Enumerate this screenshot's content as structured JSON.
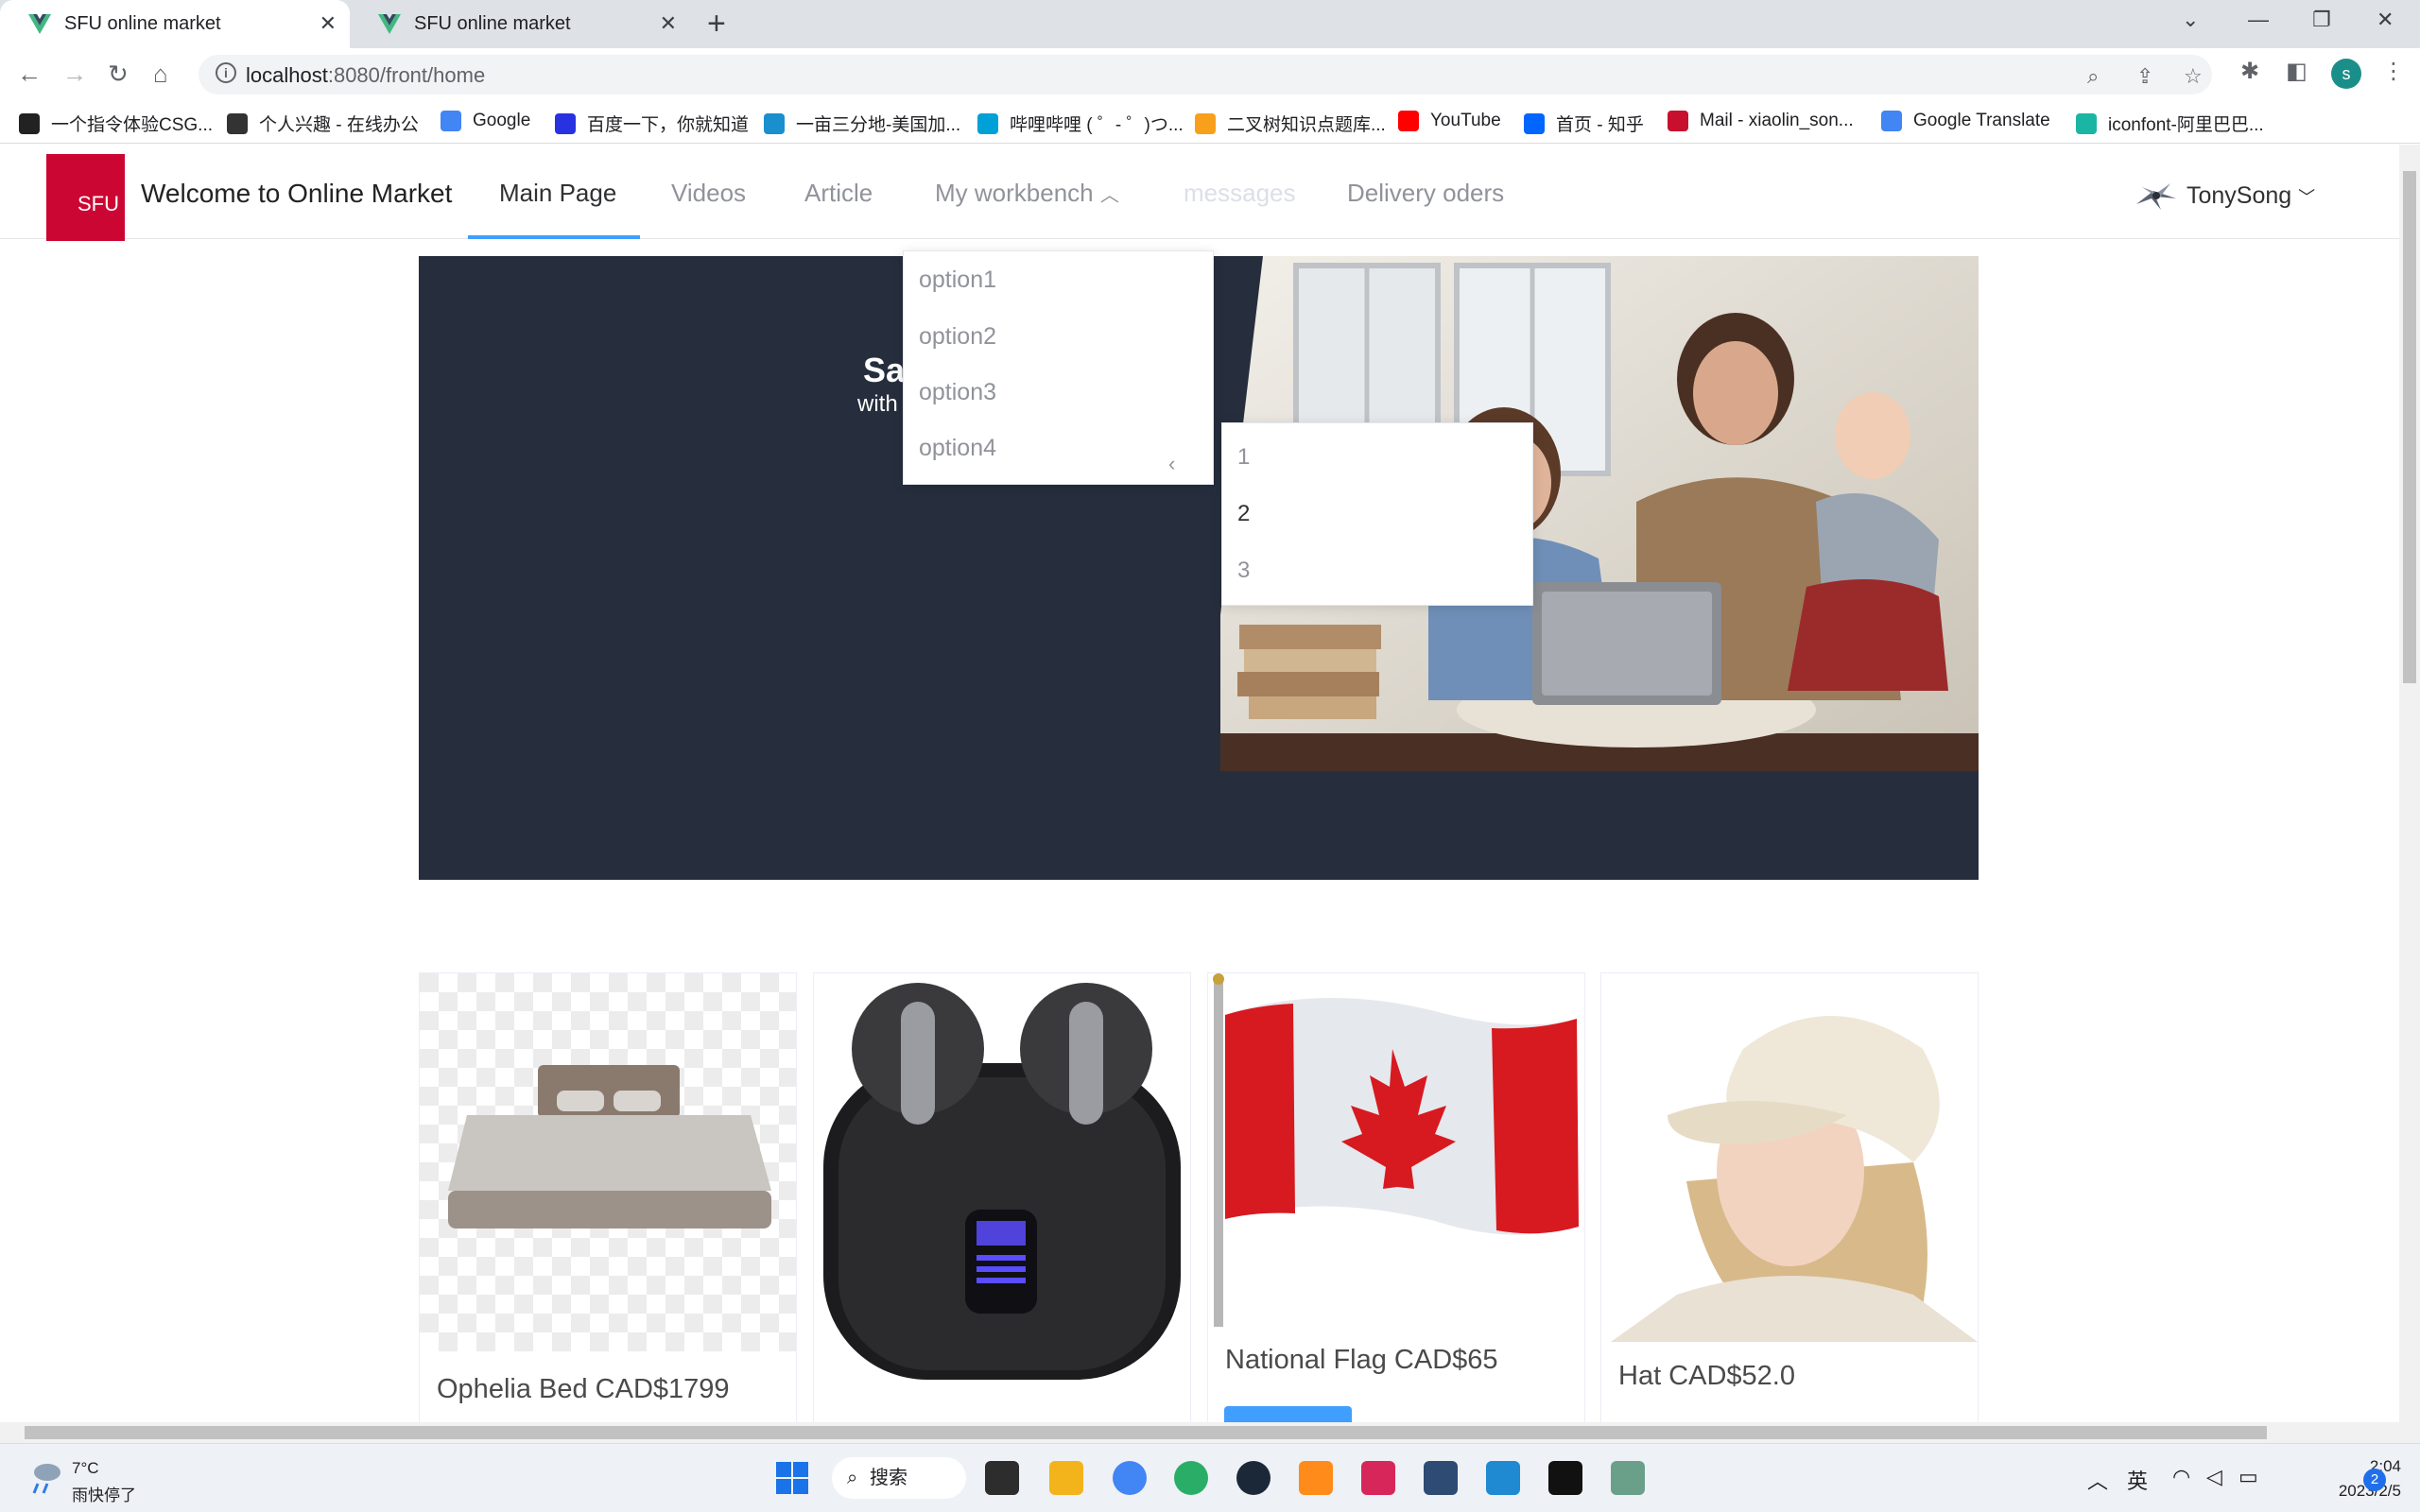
{
  "browser": {
    "tabs": [
      {
        "title": "SFU online market",
        "active": true
      },
      {
        "title": "SFU online market",
        "active": false
      }
    ],
    "url_host": "localhost",
    "url_path": ":8080/front/home",
    "profile_initial": "s",
    "bookmarks": [
      {
        "label": "一个指令体验CSG...",
        "icon": "csg-icon",
        "color": "#222222"
      },
      {
        "label": "个人兴趣 - 在线办公",
        "icon": "notion-icon",
        "color": "#333333"
      },
      {
        "label": "Google",
        "icon": "google-icon",
        "color": "#4285f4"
      },
      {
        "label": "百度一下，你就知道",
        "icon": "baidu-icon",
        "color": "#2932e1"
      },
      {
        "label": "一亩三分地-美国加...",
        "icon": "1point3acres-icon",
        "color": "#1a8fce"
      },
      {
        "label": "哔哩哔哩 ( ゜- ゜)つ...",
        "icon": "bilibili-icon",
        "color": "#00a1d6"
      },
      {
        "label": "二叉树知识点题库...",
        "icon": "leetcode-icon",
        "color": "#f89f1b"
      },
      {
        "label": "YouTube",
        "icon": "youtube-icon",
        "color": "#ff0000"
      },
      {
        "label": "首页 - 知乎",
        "icon": "zhihu-icon",
        "color": "#0066ff"
      },
      {
        "label": "Mail - xiaolin_son...",
        "icon": "mail-icon",
        "color": "#c8102e"
      },
      {
        "label": "Google Translate",
        "icon": "translate-icon",
        "color": "#4285f4"
      },
      {
        "label": "iconfont-阿里巴巴...",
        "icon": "iconfont-icon",
        "color": "#1bb5a3"
      }
    ]
  },
  "header": {
    "logo_text": "SFU",
    "site_title": "Welcome to Online Market",
    "menu": [
      "Main Page",
      "Videos",
      "Article",
      "My workbench",
      "messages",
      "Delivery oders"
    ],
    "user_name": "TonySong"
  },
  "banner": {
    "title_partial": "Sa",
    "subtitle_partial": "with"
  },
  "workbench_dropdown": {
    "options": [
      "option1",
      "option2",
      "option3",
      "option4"
    ],
    "submenu": [
      "1",
      "2",
      "3"
    ]
  },
  "products": [
    {
      "name": "Ophelia Bed CAD$1799"
    },
    {
      "name": ""
    },
    {
      "name": "National Flag CAD$65"
    },
    {
      "name": "Hat CAD$52.0"
    }
  ],
  "taskbar": {
    "weather_temp": "7°C",
    "weather_desc": "雨快停了",
    "search_label": "搜索",
    "time": "2:04",
    "date": "2023/2/5",
    "ime": "英",
    "notifications": "2"
  },
  "colors": {
    "brand_red": "#cc0633",
    "accent_blue": "#409eff",
    "banner_bg": "#262e3d"
  }
}
